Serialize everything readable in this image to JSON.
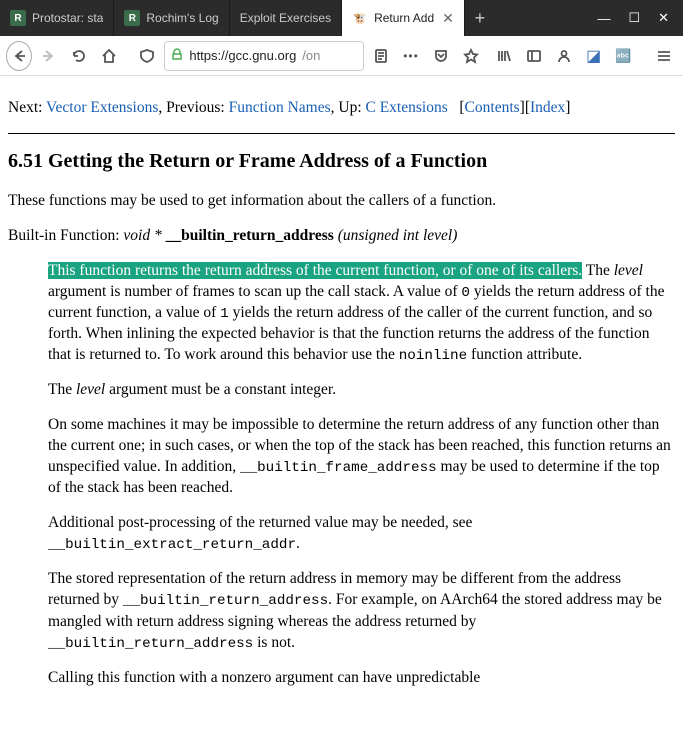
{
  "window": {
    "tabs": [
      {
        "label": "Protostar: sta",
        "favicon": "R"
      },
      {
        "label": "Rochim's Log",
        "favicon": "R"
      },
      {
        "label": "Exploit Exercises",
        "favicon": ""
      },
      {
        "label": "Return Add",
        "favicon": "gcc",
        "active": true
      }
    ],
    "newtab": "+",
    "controls": {
      "min": "—",
      "max": "☐",
      "close": "✕"
    }
  },
  "toolbar": {
    "url_domain": "https://gcc.gnu.org",
    "url_path": "/on",
    "shield": "⛊",
    "lock": "🔒",
    "reader": "☰",
    "more": "•••",
    "pocket": "⌄",
    "star": "☆"
  },
  "page": {
    "nav": {
      "next_label": "Next:",
      "next_link": "Vector Extensions",
      "prev_label": ", Previous:",
      "prev_link": "Function Names",
      "up_label": ", Up:",
      "up_link": "C Extensions",
      "contents": "Contents",
      "index": "Index"
    },
    "heading": "6.51 Getting the Return or Frame Address of a Function",
    "intro": "These functions may be used to get information about the callers of a function.",
    "builtin": {
      "kind": "Built-in Function:",
      "ret": "void *",
      "name": "__builtin_return_address",
      "args": "(unsigned int level)"
    },
    "p1": {
      "hl": "This function returns the return address of the current function, or of one of its callers.",
      "a": " The ",
      "level": "level",
      "b": " argument is number of frames to scan up the call stack. A value of ",
      "zero": "0",
      "c": " yields the return address of the current function, a value of ",
      "one": "1",
      "d": " yields the return address of the caller of the current function, and so forth. When inlining the expected behavior is that the function returns the address of the function that is returned to. To work around this behavior use the ",
      "noinline": "noinline",
      "e": " function attribute."
    },
    "p2": {
      "a": "The ",
      "level": "level",
      "b": " argument must be a constant integer."
    },
    "p3": {
      "a": "On some machines it may be impossible to determine the return address of any function other than the current one; in such cases, or when the top of the stack has been reached, this function returns an unspecified value. In addition, ",
      "fn": "__builtin_frame_address",
      "b": " may be used to determine if the top of the stack has been reached."
    },
    "p4": {
      "a": "Additional post-processing of the returned value may be needed, see ",
      "fn": "__builtin_extract_return_addr",
      "b": "."
    },
    "p5": {
      "a": "The stored representation of the return address in memory may be different from the address returned by ",
      "fn1": "__builtin_return_address",
      "b": ". For example, on AArch64 the stored address may be mangled with return address signing whereas the address returned by ",
      "fn2": "__builtin_return_address",
      "c": " is not."
    },
    "p6": "Calling this function with a nonzero argument can have unpredictable"
  }
}
